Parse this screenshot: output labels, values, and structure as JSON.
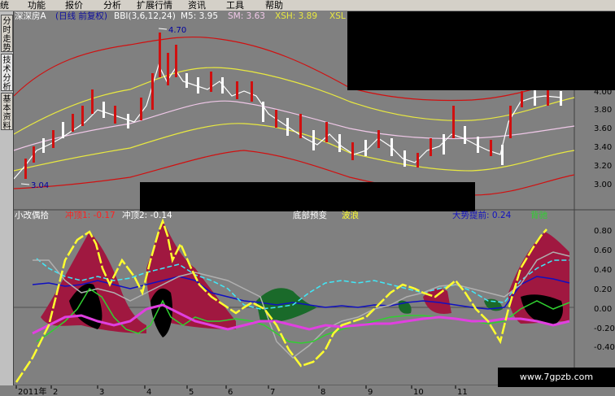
{
  "menu": [
    "统",
    "功能",
    "报价",
    "分析",
    "扩展行情",
    "资讯",
    "工具",
    "帮助"
  ],
  "tabs": [
    "分时走势",
    "技术分析",
    "基本资料"
  ],
  "main_header": {
    "title": "深深房A",
    "mode": "(日线 前复权)",
    "indicator": "BBI(3,6,12,24)",
    "m5": "M5: 3.95",
    "sm": "SM: 3.63",
    "xsh": "XSH: 3.89",
    "xsl": "XSL"
  },
  "annotations": {
    "high": "4.70",
    "low": "3.04"
  },
  "sub_header": {
    "name": "小改偶拾",
    "cd1": "冲顶1: -0.17",
    "cd2": "冲顶2: -0.14",
    "lbl3": "底部预变",
    "lbl4": "波浪",
    "lbl5": "大势提前: 0.24",
    "lbl6": "背驰"
  },
  "axis_main": [
    "4.00",
    "3.80",
    "3.60",
    "3.40",
    "3.20",
    "3.00"
  ],
  "axis_sub": [
    "0.80",
    "0.60",
    "0.40",
    "0.20",
    "0.00",
    "-0.20",
    "-0.40"
  ],
  "months": [
    "2011年",
    "2",
    "3",
    "4",
    "5",
    "6",
    "7",
    "8",
    "9",
    "10",
    "11"
  ],
  "watermark": "www.7gpzb.com",
  "colors": {
    "bg": "#808080",
    "upper_band": "#d01010",
    "mid_band": "#e8e840",
    "ma_white": "#f0c8e8",
    "cyan": "#40e8f8",
    "blue": "#1010c0",
    "green": "#30d030",
    "yellow": "#ffff30",
    "magenta": "#e040e0",
    "crimson": "#a01840"
  }
}
